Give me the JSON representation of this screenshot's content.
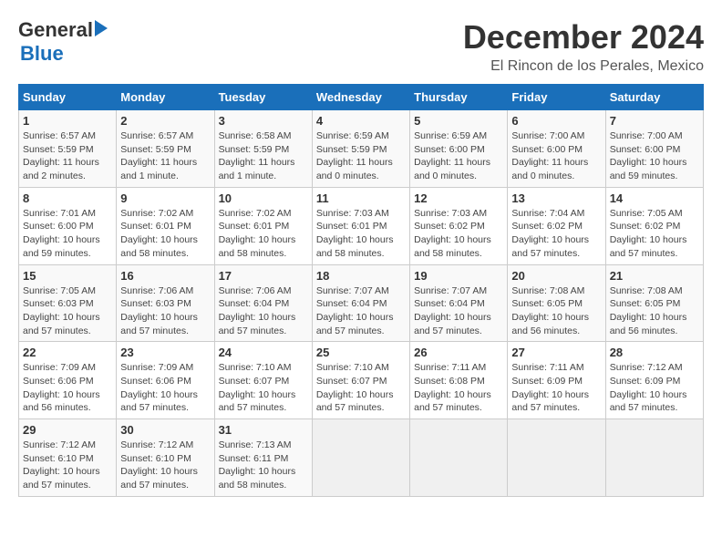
{
  "logo": {
    "general": "General",
    "blue": "Blue"
  },
  "title": "December 2024",
  "subtitle": "El Rincon de los Perales, Mexico",
  "headers": [
    "Sunday",
    "Monday",
    "Tuesday",
    "Wednesday",
    "Thursday",
    "Friday",
    "Saturday"
  ],
  "weeks": [
    [
      {
        "day": "1",
        "info": "Sunrise: 6:57 AM\nSunset: 5:59 PM\nDaylight: 11 hours\nand 2 minutes."
      },
      {
        "day": "2",
        "info": "Sunrise: 6:57 AM\nSunset: 5:59 PM\nDaylight: 11 hours\nand 1 minute."
      },
      {
        "day": "3",
        "info": "Sunrise: 6:58 AM\nSunset: 5:59 PM\nDaylight: 11 hours\nand 1 minute."
      },
      {
        "day": "4",
        "info": "Sunrise: 6:59 AM\nSunset: 5:59 PM\nDaylight: 11 hours\nand 0 minutes."
      },
      {
        "day": "5",
        "info": "Sunrise: 6:59 AM\nSunset: 6:00 PM\nDaylight: 11 hours\nand 0 minutes."
      },
      {
        "day": "6",
        "info": "Sunrise: 7:00 AM\nSunset: 6:00 PM\nDaylight: 11 hours\nand 0 minutes."
      },
      {
        "day": "7",
        "info": "Sunrise: 7:00 AM\nSunset: 6:00 PM\nDaylight: 10 hours\nand 59 minutes."
      }
    ],
    [
      {
        "day": "8",
        "info": "Sunrise: 7:01 AM\nSunset: 6:00 PM\nDaylight: 10 hours\nand 59 minutes."
      },
      {
        "day": "9",
        "info": "Sunrise: 7:02 AM\nSunset: 6:01 PM\nDaylight: 10 hours\nand 58 minutes."
      },
      {
        "day": "10",
        "info": "Sunrise: 7:02 AM\nSunset: 6:01 PM\nDaylight: 10 hours\nand 58 minutes."
      },
      {
        "day": "11",
        "info": "Sunrise: 7:03 AM\nSunset: 6:01 PM\nDaylight: 10 hours\nand 58 minutes."
      },
      {
        "day": "12",
        "info": "Sunrise: 7:03 AM\nSunset: 6:02 PM\nDaylight: 10 hours\nand 58 minutes."
      },
      {
        "day": "13",
        "info": "Sunrise: 7:04 AM\nSunset: 6:02 PM\nDaylight: 10 hours\nand 57 minutes."
      },
      {
        "day": "14",
        "info": "Sunrise: 7:05 AM\nSunset: 6:02 PM\nDaylight: 10 hours\nand 57 minutes."
      }
    ],
    [
      {
        "day": "15",
        "info": "Sunrise: 7:05 AM\nSunset: 6:03 PM\nDaylight: 10 hours\nand 57 minutes."
      },
      {
        "day": "16",
        "info": "Sunrise: 7:06 AM\nSunset: 6:03 PM\nDaylight: 10 hours\nand 57 minutes."
      },
      {
        "day": "17",
        "info": "Sunrise: 7:06 AM\nSunset: 6:04 PM\nDaylight: 10 hours\nand 57 minutes."
      },
      {
        "day": "18",
        "info": "Sunrise: 7:07 AM\nSunset: 6:04 PM\nDaylight: 10 hours\nand 57 minutes."
      },
      {
        "day": "19",
        "info": "Sunrise: 7:07 AM\nSunset: 6:04 PM\nDaylight: 10 hours\nand 57 minutes."
      },
      {
        "day": "20",
        "info": "Sunrise: 7:08 AM\nSunset: 6:05 PM\nDaylight: 10 hours\nand 56 minutes."
      },
      {
        "day": "21",
        "info": "Sunrise: 7:08 AM\nSunset: 6:05 PM\nDaylight: 10 hours\nand 56 minutes."
      }
    ],
    [
      {
        "day": "22",
        "info": "Sunrise: 7:09 AM\nSunset: 6:06 PM\nDaylight: 10 hours\nand 56 minutes."
      },
      {
        "day": "23",
        "info": "Sunrise: 7:09 AM\nSunset: 6:06 PM\nDaylight: 10 hours\nand 57 minutes."
      },
      {
        "day": "24",
        "info": "Sunrise: 7:10 AM\nSunset: 6:07 PM\nDaylight: 10 hours\nand 57 minutes."
      },
      {
        "day": "25",
        "info": "Sunrise: 7:10 AM\nSunset: 6:07 PM\nDaylight: 10 hours\nand 57 minutes."
      },
      {
        "day": "26",
        "info": "Sunrise: 7:11 AM\nSunset: 6:08 PM\nDaylight: 10 hours\nand 57 minutes."
      },
      {
        "day": "27",
        "info": "Sunrise: 7:11 AM\nSunset: 6:09 PM\nDaylight: 10 hours\nand 57 minutes."
      },
      {
        "day": "28",
        "info": "Sunrise: 7:12 AM\nSunset: 6:09 PM\nDaylight: 10 hours\nand 57 minutes."
      }
    ],
    [
      {
        "day": "29",
        "info": "Sunrise: 7:12 AM\nSunset: 6:10 PM\nDaylight: 10 hours\nand 57 minutes."
      },
      {
        "day": "30",
        "info": "Sunrise: 7:12 AM\nSunset: 6:10 PM\nDaylight: 10 hours\nand 57 minutes."
      },
      {
        "day": "31",
        "info": "Sunrise: 7:13 AM\nSunset: 6:11 PM\nDaylight: 10 hours\nand 58 minutes."
      },
      {
        "day": "",
        "info": ""
      },
      {
        "day": "",
        "info": ""
      },
      {
        "day": "",
        "info": ""
      },
      {
        "day": "",
        "info": ""
      }
    ]
  ]
}
